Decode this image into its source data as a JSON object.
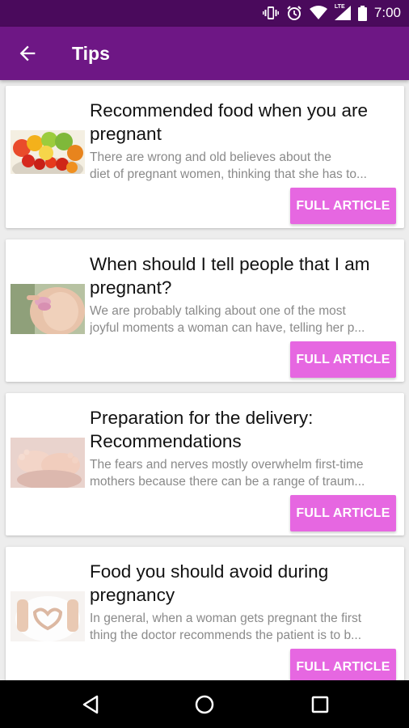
{
  "status_bar": {
    "time": "7:00",
    "network_label": "LTE"
  },
  "app_bar": {
    "title": "Tips"
  },
  "articles": [
    {
      "title": "Recommended food when you are pregnant",
      "desc_line1": "There are wrong and old believes about the",
      "desc_line2": "diet of pregnant women, thinking that she has to...",
      "button": "FULL ARTICLE"
    },
    {
      "title": "When should I tell people that I am pregnant?",
      "desc_line1": "We are probably talking about one of the most",
      "desc_line2": "joyful moments a woman can have, telling her p...",
      "button": "FULL ARTICLE"
    },
    {
      "title": "Preparation for the delivery: Recommendations",
      "desc_line1": "The fears and nerves mostly overwhelm first-time",
      "desc_line2": "mothers because there can be a range of traum...",
      "button": "FULL ARTICLE"
    },
    {
      "title": "Food you should avoid during pregnancy",
      "desc_line1": "In general, when a woman gets pregnant the first",
      "desc_line2": "thing the doctor recommends the patient is to b...",
      "button": "FULL ARTICLE"
    }
  ],
  "icons": {
    "back": "arrow-left-icon",
    "vibrate": "vibrate-icon",
    "alarm": "alarm-icon",
    "wifi": "wifi-icon",
    "signal": "cell-signal-icon",
    "battery": "battery-icon",
    "nav_back": "nav-back-icon",
    "nav_home": "nav-home-icon",
    "nav_recents": "nav-recents-icon"
  },
  "colors": {
    "status_bar": "#4a0a5c",
    "app_bar": "#6e1785",
    "button": "#e667e1",
    "background": "#ededed"
  }
}
